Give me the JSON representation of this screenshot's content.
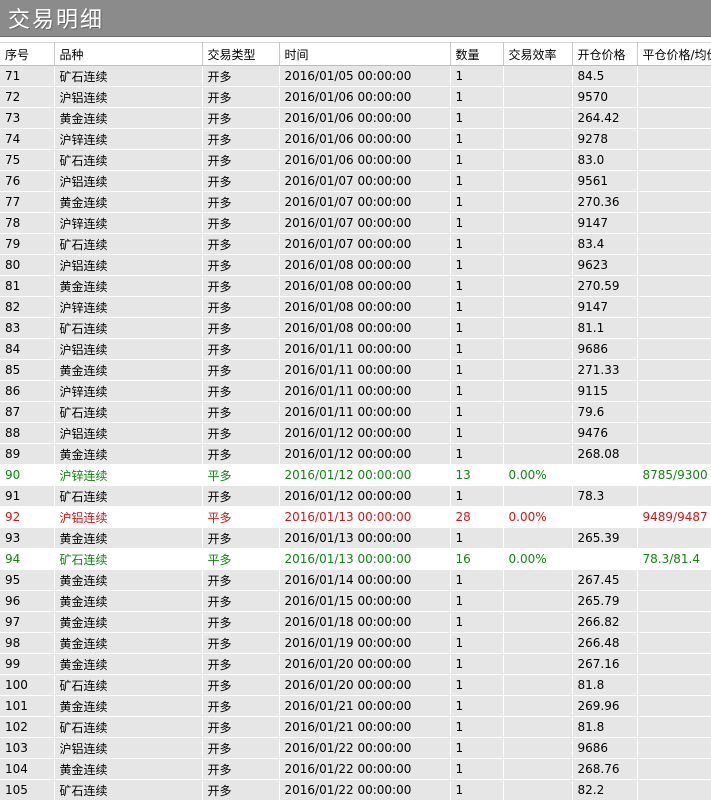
{
  "title": "交易明细",
  "colors": {
    "green": "#0a8a0a",
    "red": "#e01010",
    "row_bg": "#e6e6e6"
  },
  "columns": [
    "序号",
    "品种",
    "交易类型",
    "时间",
    "数量",
    "交易效率",
    "开仓价格",
    "平仓价格/均价"
  ],
  "rows": [
    {
      "id": "71",
      "symbol": "矿石连续",
      "type": "开多",
      "time": "2016/01/05 00:00:00",
      "qty": "1",
      "eff": "",
      "open": "84.5",
      "close": "",
      "style": "normal"
    },
    {
      "id": "72",
      "symbol": "沪铝连续",
      "type": "开多",
      "time": "2016/01/06 00:00:00",
      "qty": "1",
      "eff": "",
      "open": "9570",
      "close": "",
      "style": "normal"
    },
    {
      "id": "73",
      "symbol": "黄金连续",
      "type": "开多",
      "time": "2016/01/06 00:00:00",
      "qty": "1",
      "eff": "",
      "open": "264.42",
      "close": "",
      "style": "normal"
    },
    {
      "id": "74",
      "symbol": "沪锌连续",
      "type": "开多",
      "time": "2016/01/06 00:00:00",
      "qty": "1",
      "eff": "",
      "open": "9278",
      "close": "",
      "style": "normal"
    },
    {
      "id": "75",
      "symbol": "矿石连续",
      "type": "开多",
      "time": "2016/01/06 00:00:00",
      "qty": "1",
      "eff": "",
      "open": "83.0",
      "close": "",
      "style": "normal"
    },
    {
      "id": "76",
      "symbol": "沪铝连续",
      "type": "开多",
      "time": "2016/01/07 00:00:00",
      "qty": "1",
      "eff": "",
      "open": "9561",
      "close": "",
      "style": "normal"
    },
    {
      "id": "77",
      "symbol": "黄金连续",
      "type": "开多",
      "time": "2016/01/07 00:00:00",
      "qty": "1",
      "eff": "",
      "open": "270.36",
      "close": "",
      "style": "normal"
    },
    {
      "id": "78",
      "symbol": "沪锌连续",
      "type": "开多",
      "time": "2016/01/07 00:00:00",
      "qty": "1",
      "eff": "",
      "open": "9147",
      "close": "",
      "style": "normal"
    },
    {
      "id": "79",
      "symbol": "矿石连续",
      "type": "开多",
      "time": "2016/01/07 00:00:00",
      "qty": "1",
      "eff": "",
      "open": "83.4",
      "close": "",
      "style": "normal"
    },
    {
      "id": "80",
      "symbol": "沪铝连续",
      "type": "开多",
      "time": "2016/01/08 00:00:00",
      "qty": "1",
      "eff": "",
      "open": "9623",
      "close": "",
      "style": "normal"
    },
    {
      "id": "81",
      "symbol": "黄金连续",
      "type": "开多",
      "time": "2016/01/08 00:00:00",
      "qty": "1",
      "eff": "",
      "open": "270.59",
      "close": "",
      "style": "normal"
    },
    {
      "id": "82",
      "symbol": "沪锌连续",
      "type": "开多",
      "time": "2016/01/08 00:00:00",
      "qty": "1",
      "eff": "",
      "open": "9147",
      "close": "",
      "style": "normal"
    },
    {
      "id": "83",
      "symbol": "矿石连续",
      "type": "开多",
      "time": "2016/01/08 00:00:00",
      "qty": "1",
      "eff": "",
      "open": "81.1",
      "close": "",
      "style": "normal"
    },
    {
      "id": "84",
      "symbol": "沪铝连续",
      "type": "开多",
      "time": "2016/01/11 00:00:00",
      "qty": "1",
      "eff": "",
      "open": "9686",
      "close": "",
      "style": "normal"
    },
    {
      "id": "85",
      "symbol": "黄金连续",
      "type": "开多",
      "time": "2016/01/11 00:00:00",
      "qty": "1",
      "eff": "",
      "open": "271.33",
      "close": "",
      "style": "normal"
    },
    {
      "id": "86",
      "symbol": "沪锌连续",
      "type": "开多",
      "time": "2016/01/11 00:00:00",
      "qty": "1",
      "eff": "",
      "open": "9115",
      "close": "",
      "style": "normal"
    },
    {
      "id": "87",
      "symbol": "矿石连续",
      "type": "开多",
      "time": "2016/01/11 00:00:00",
      "qty": "1",
      "eff": "",
      "open": "79.6",
      "close": "",
      "style": "normal"
    },
    {
      "id": "88",
      "symbol": "沪铝连续",
      "type": "开多",
      "time": "2016/01/12 00:00:00",
      "qty": "1",
      "eff": "",
      "open": "9476",
      "close": "",
      "style": "normal"
    },
    {
      "id": "89",
      "symbol": "黄金连续",
      "type": "开多",
      "time": "2016/01/12 00:00:00",
      "qty": "1",
      "eff": "",
      "open": "268.08",
      "close": "",
      "style": "normal"
    },
    {
      "id": "90",
      "symbol": "沪锌连续",
      "type": "平多",
      "time": "2016/01/12 00:00:00",
      "qty": "13",
      "eff": "0.00%",
      "open": "",
      "close": "8785/9300",
      "style": "green"
    },
    {
      "id": "91",
      "symbol": "矿石连续",
      "type": "开多",
      "time": "2016/01/12 00:00:00",
      "qty": "1",
      "eff": "",
      "open": "78.3",
      "close": "",
      "style": "normal"
    },
    {
      "id": "92",
      "symbol": "沪铝连续",
      "type": "平多",
      "time": "2016/01/13 00:00:00",
      "qty": "28",
      "eff": "0.00%",
      "open": "",
      "close": "9489/9487",
      "style": "red"
    },
    {
      "id": "93",
      "symbol": "黄金连续",
      "type": "开多",
      "time": "2016/01/13 00:00:00",
      "qty": "1",
      "eff": "",
      "open": "265.39",
      "close": "",
      "style": "normal"
    },
    {
      "id": "94",
      "symbol": "矿石连续",
      "type": "平多",
      "time": "2016/01/13 00:00:00",
      "qty": "16",
      "eff": "0.00%",
      "open": "",
      "close": "78.3/81.4",
      "style": "green"
    },
    {
      "id": "95",
      "symbol": "黄金连续",
      "type": "开多",
      "time": "2016/01/14 00:00:00",
      "qty": "1",
      "eff": "",
      "open": "267.45",
      "close": "",
      "style": "normal"
    },
    {
      "id": "96",
      "symbol": "黄金连续",
      "type": "开多",
      "time": "2016/01/15 00:00:00",
      "qty": "1",
      "eff": "",
      "open": "265.79",
      "close": "",
      "style": "normal"
    },
    {
      "id": "97",
      "symbol": "黄金连续",
      "type": "开多",
      "time": "2016/01/18 00:00:00",
      "qty": "1",
      "eff": "",
      "open": "266.82",
      "close": "",
      "style": "normal"
    },
    {
      "id": "98",
      "symbol": "黄金连续",
      "type": "开多",
      "time": "2016/01/19 00:00:00",
      "qty": "1",
      "eff": "",
      "open": "266.48",
      "close": "",
      "style": "normal"
    },
    {
      "id": "99",
      "symbol": "黄金连续",
      "type": "开多",
      "time": "2016/01/20 00:00:00",
      "qty": "1",
      "eff": "",
      "open": "267.16",
      "close": "",
      "style": "normal"
    },
    {
      "id": "100",
      "symbol": "矿石连续",
      "type": "开多",
      "time": "2016/01/20 00:00:00",
      "qty": "1",
      "eff": "",
      "open": "81.8",
      "close": "",
      "style": "normal"
    },
    {
      "id": "101",
      "symbol": "黄金连续",
      "type": "开多",
      "time": "2016/01/21 00:00:00",
      "qty": "1",
      "eff": "",
      "open": "269.96",
      "close": "",
      "style": "normal"
    },
    {
      "id": "102",
      "symbol": "矿石连续",
      "type": "开多",
      "time": "2016/01/21 00:00:00",
      "qty": "1",
      "eff": "",
      "open": "81.8",
      "close": "",
      "style": "normal"
    },
    {
      "id": "103",
      "symbol": "沪铝连续",
      "type": "开多",
      "time": "2016/01/22 00:00:00",
      "qty": "1",
      "eff": "",
      "open": "9686",
      "close": "",
      "style": "normal"
    },
    {
      "id": "104",
      "symbol": "黄金连续",
      "type": "开多",
      "time": "2016/01/22 00:00:00",
      "qty": "1",
      "eff": "",
      "open": "268.76",
      "close": "",
      "style": "normal"
    },
    {
      "id": "105",
      "symbol": "矿石连续",
      "type": "开多",
      "time": "2016/01/22 00:00:00",
      "qty": "1",
      "eff": "",
      "open": "82.2",
      "close": "",
      "style": "normal"
    }
  ]
}
